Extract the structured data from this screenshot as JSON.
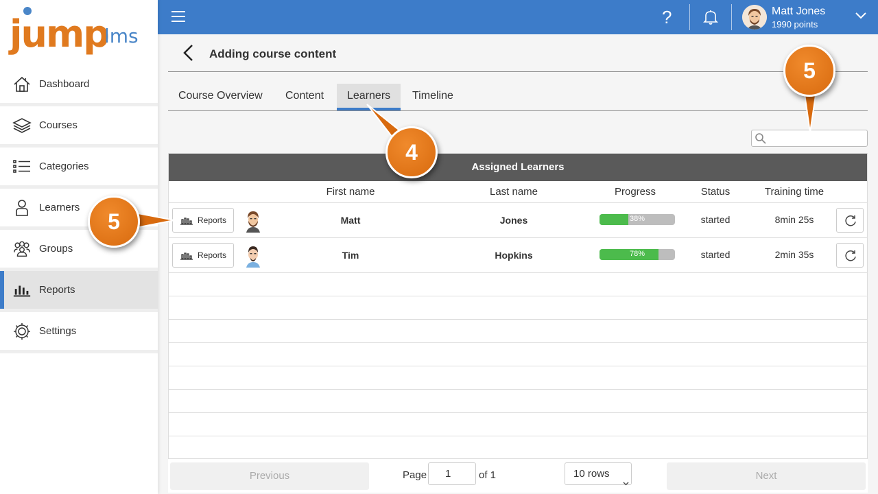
{
  "brand": {
    "logo_main": "jump",
    "logo_sub": "lms",
    "accent": "#3d7cc9",
    "orange": "#e07a1f"
  },
  "sidebar": {
    "items": [
      {
        "label": "Dashboard",
        "icon": "home-icon",
        "active": false
      },
      {
        "label": "Courses",
        "icon": "stack-icon",
        "active": false
      },
      {
        "label": "Categories",
        "icon": "list-icon",
        "active": false
      },
      {
        "label": "Learners",
        "icon": "person-icon",
        "active": false
      },
      {
        "label": "Groups",
        "icon": "group-icon",
        "active": false
      },
      {
        "label": "Reports",
        "icon": "bar-chart-icon",
        "active": true
      },
      {
        "label": "Settings",
        "icon": "gear-icon",
        "active": false
      }
    ]
  },
  "header": {
    "help": "?",
    "user_name": "Matt Jones",
    "user_points": "1990 points"
  },
  "page": {
    "title": "Adding course content"
  },
  "tabs": [
    {
      "label": "Course Overview",
      "active": false
    },
    {
      "label": "Content",
      "active": false
    },
    {
      "label": "Learners",
      "active": true
    },
    {
      "label": "Timeline",
      "active": false
    }
  ],
  "search": {
    "placeholder": "",
    "value": ""
  },
  "table": {
    "title": "Assigned Learners",
    "columns": [
      "First name",
      "Last name",
      "Progress",
      "Status",
      "Training time"
    ],
    "report_label": "Reports",
    "rows": [
      {
        "first_name": "Matt",
        "last_name": "Jones",
        "progress": 38,
        "progress_label": "38%",
        "status": "started",
        "training_time": "8min 25s"
      },
      {
        "first_name": "Tim",
        "last_name": "Hopkins",
        "progress": 78,
        "progress_label": "78%",
        "status": "started",
        "training_time": "2min 35s"
      }
    ]
  },
  "pagination": {
    "previous": "Previous",
    "page_label": "Page",
    "page_value": "1",
    "of_label": "of 1",
    "rows_select": "10 rows",
    "next": "Next"
  },
  "callouts": {
    "tab_callout": "4",
    "search_callout": "5",
    "reports_callout": "5"
  }
}
